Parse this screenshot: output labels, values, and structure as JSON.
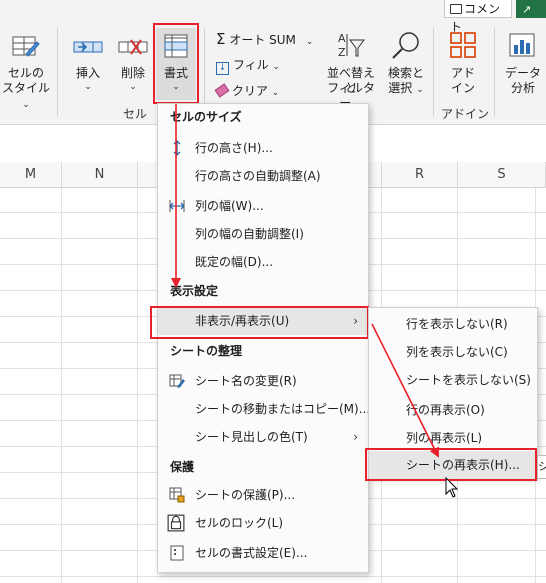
{
  "ribbon": {
    "comment_button": "コメント",
    "cell_style": {
      "line1": "セルの",
      "line2": "スタイル"
    },
    "insert": "挿入",
    "delete": "削除",
    "format": "書式",
    "cells_group_label": "セル",
    "autosum": "オート SUM",
    "fill": "フィル",
    "clear": "クリア",
    "sort_filter": {
      "line1": "並べ替えと",
      "line2": "フィルター"
    },
    "find_select": {
      "line1": "検索と",
      "line2": "選択"
    },
    "addin": {
      "line1": "アド",
      "line2": "イン"
    },
    "addin_group_label": "アドイン",
    "data_analysis": {
      "line1": "データ",
      "line2": "分析"
    }
  },
  "columns": [
    "M",
    "N",
    "R",
    "S"
  ],
  "format_menu": {
    "section_cell_size": "セルのサイズ",
    "row_height": "行の高さ(H)...",
    "autofit_row_height": "行の高さの自動調整(A)",
    "column_width": "列の幅(W)...",
    "autofit_column_width": "列の幅の自動調整(I)",
    "default_width": "既定の幅(D)...",
    "section_visibility": "表示設定",
    "hide_unhide": "非表示/再表示(U)",
    "section_organize": "シートの整理",
    "rename_sheet": "シート名の変更(R)",
    "move_copy_sheet": "シートの移動またはコピー(M)...",
    "tab_color": "シート見出しの色(T)",
    "section_protection": "保護",
    "protect_sheet": "シートの保護(P)...",
    "lock_cell": "セルのロック(L)",
    "format_cells": "セルの書式設定(E)..."
  },
  "hide_submenu": {
    "hide_rows": "行を表示しない(R)",
    "hide_columns": "列を表示しない(C)",
    "hide_sheet": "シートを表示しない(S)",
    "unhide_rows": "行の再表示(O)",
    "unhide_columns": "列の再表示(L)",
    "unhide_sheet": "シートの再表示(H)..."
  },
  "colors": {
    "annotation_red": "#e8202b",
    "accent_green": "#217346",
    "icon_blue": "#2b6cb0"
  }
}
